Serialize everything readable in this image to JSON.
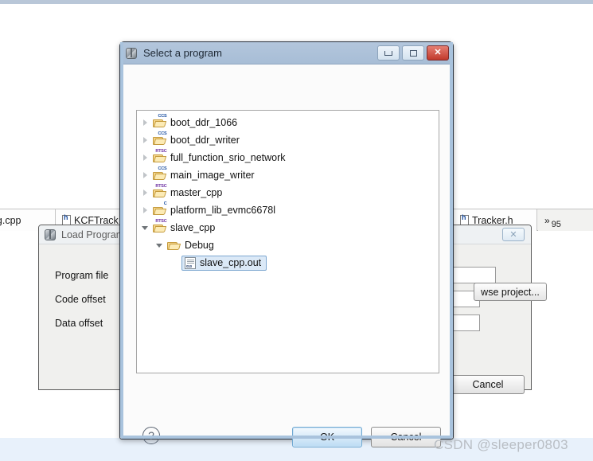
{
  "background": {
    "editor_tabs": [
      {
        "label": "peg.cpp",
        "icon": "none"
      },
      {
        "label": "KCFTrack",
        "icon": "header-file-icon"
      },
      {
        "label": "Tracker.h",
        "icon": "header-file-icon"
      }
    ],
    "tab_overflow": {
      "chevron": "»",
      "count": "95"
    }
  },
  "load_program_dialog": {
    "title": "Load Program",
    "icon": "app-cube-icon",
    "close_label": "✕",
    "fields": [
      {
        "label": "Program file",
        "value": ""
      },
      {
        "label": "Code offset",
        "value": ""
      },
      {
        "label": "Data offset",
        "value": ""
      }
    ],
    "browse_button": "wse project...",
    "cancel_button": "Cancel"
  },
  "select_program_dialog": {
    "title": "Select a program",
    "icon": "app-cube-icon",
    "window_buttons": {
      "minimize": "minimize-icon",
      "maximize": "maximize-icon",
      "close": "✕"
    },
    "tree": [
      {
        "label": "boot_ddr_1066",
        "indent": 0,
        "arrow": "collapsed",
        "icon": "project-folder",
        "badge": "CCS",
        "selected": false
      },
      {
        "label": "boot_ddr_writer",
        "indent": 0,
        "arrow": "collapsed",
        "icon": "project-folder",
        "badge": "CCS",
        "selected": false
      },
      {
        "label": "full_function_srio_network",
        "indent": 0,
        "arrow": "collapsed",
        "icon": "project-folder",
        "badge": "RTSC",
        "selected": false
      },
      {
        "label": "main_image_writer",
        "indent": 0,
        "arrow": "collapsed",
        "icon": "project-folder",
        "badge": "CCS",
        "selected": false
      },
      {
        "label": "master_cpp",
        "indent": 0,
        "arrow": "collapsed",
        "icon": "project-folder",
        "badge": "RTSC",
        "selected": false
      },
      {
        "label": "platform_lib_evmc6678l",
        "indent": 0,
        "arrow": "collapsed",
        "icon": "project-folder",
        "badge": "C",
        "selected": false
      },
      {
        "label": "slave_cpp",
        "indent": 0,
        "arrow": "expanded",
        "icon": "project-folder",
        "badge": "RTSC",
        "selected": false
      },
      {
        "label": "Debug",
        "indent": 1,
        "arrow": "expanded",
        "icon": "plain-folder",
        "badge": "",
        "selected": false
      },
      {
        "label": "slave_cpp.out",
        "indent": 2,
        "arrow": "none",
        "icon": "binary-file",
        "badge": "",
        "selected": true
      }
    ],
    "help_label": "?",
    "ok_button": "OK",
    "cancel_button": "Cancel"
  },
  "watermark": "CSDN @sleeper0803",
  "colors": {
    "title_bar": "#aec2d9",
    "selection_fill": "#dbe9f7",
    "selection_border": "#7da7d0",
    "close_button": "#c1392c",
    "default_button": "#bcdcf4",
    "bottom_band": "#e8f1fb"
  }
}
